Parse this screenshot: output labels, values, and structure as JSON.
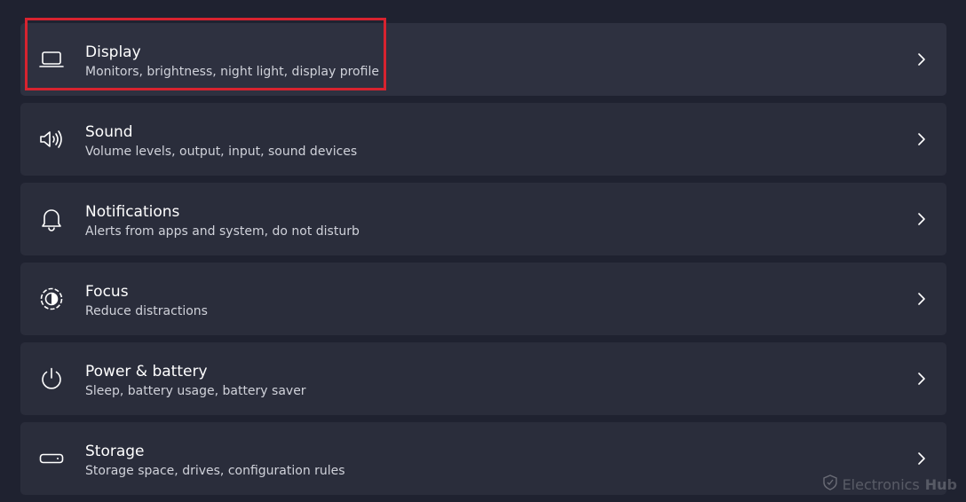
{
  "settings": {
    "items": [
      {
        "title": "Display",
        "subtitle": "Monitors, brightness, night light, display profile",
        "icon": "laptop-icon"
      },
      {
        "title": "Sound",
        "subtitle": "Volume levels, output, input, sound devices",
        "icon": "speaker-icon"
      },
      {
        "title": "Notifications",
        "subtitle": "Alerts from apps and system, do not disturb",
        "icon": "bell-icon"
      },
      {
        "title": "Focus",
        "subtitle": "Reduce distractions",
        "icon": "focus-icon"
      },
      {
        "title": "Power & battery",
        "subtitle": "Sleep, battery usage, battery saver",
        "icon": "power-icon"
      },
      {
        "title": "Storage",
        "subtitle": "Storage space, drives, configuration rules",
        "icon": "storage-drive-icon"
      }
    ]
  },
  "annotation": {
    "highlight_color": "#d7232f"
  },
  "watermark": {
    "text_a": "Electronics",
    "text_b": "Hub"
  }
}
